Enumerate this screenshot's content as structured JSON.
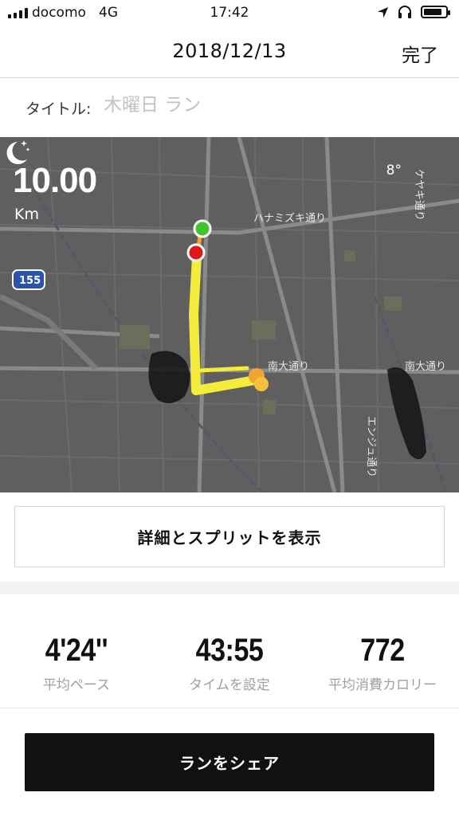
{
  "status_bar": {
    "carrier": "docomo",
    "network": "4G",
    "time": "17:42",
    "icons": [
      "signal-icon",
      "location-arrow-icon",
      "headphones-icon",
      "battery-icon"
    ]
  },
  "nav": {
    "title": "2018/12/13",
    "done_label": "完了"
  },
  "run_title": {
    "label": "タイトル:",
    "placeholder": "木曜日 ラン"
  },
  "map": {
    "distance_value": "10.00",
    "distance_unit": "Km",
    "temperature": "8°",
    "weather_icon": "moon-stars-icon",
    "road_labels": {
      "hanamizuki": "ハナミズキ通り",
      "nandai_1": "南大通り",
      "nandai_2": "南大通り",
      "enju": "エンジュ通り",
      "keyaki": "ケヤキ通り",
      "route_shield": "155"
    },
    "route_colors": {
      "route": "#f3ec3c",
      "start": "#43c42c",
      "end": "#e0161b",
      "accent": "#f2a431"
    }
  },
  "details_button": {
    "label": "詳細とスプリットを表示"
  },
  "stats": [
    {
      "value": "4'24''",
      "label": "平均ペース"
    },
    {
      "value": "43:55",
      "label": "タイムを設定"
    },
    {
      "value": "772",
      "label": "平均消費カロリー"
    }
  ],
  "share_button": {
    "label": "ランをシェア"
  }
}
